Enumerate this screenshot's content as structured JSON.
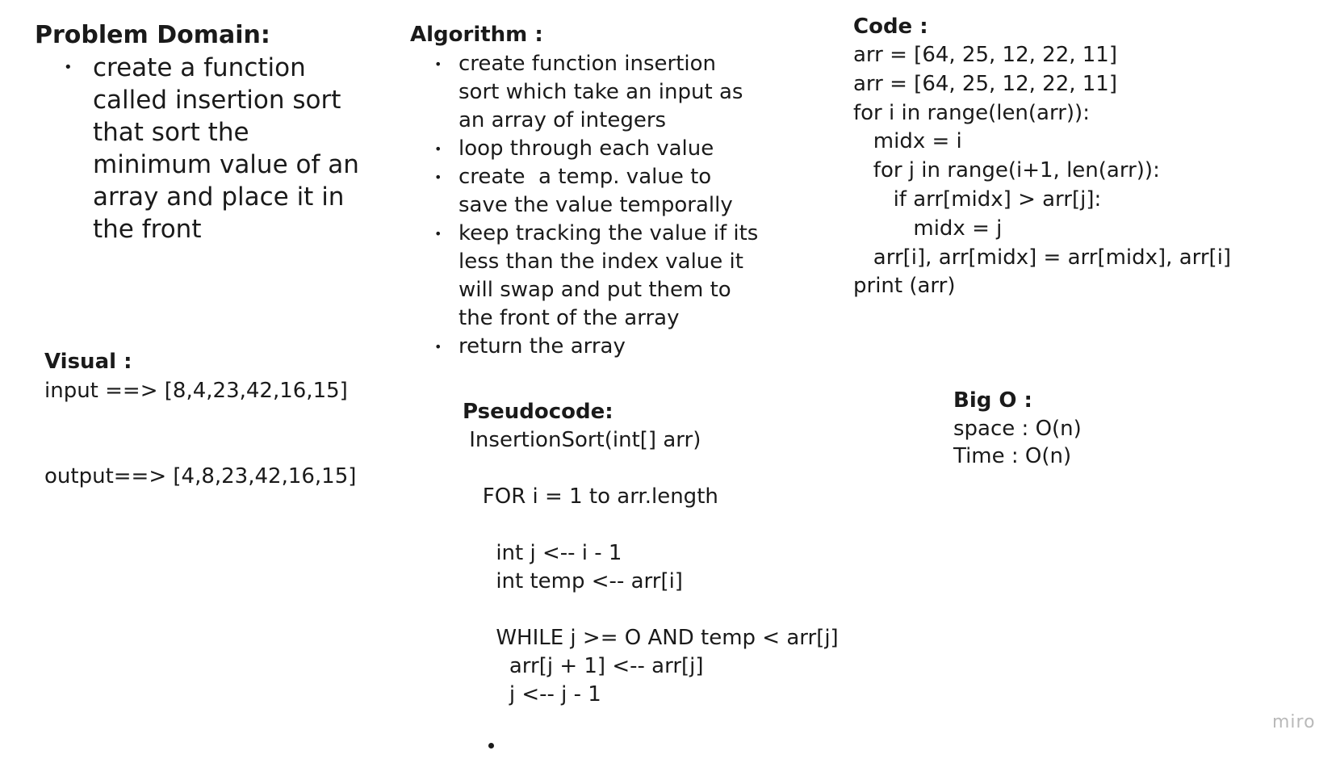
{
  "problem_domain": {
    "heading": "Problem Domain:",
    "items": [
      "create a function called insertion sort that sort the minimum value of an array and place it in the front"
    ]
  },
  "algorithm": {
    "heading": "Algorithm :",
    "items": [
      "create function insertion\nsort which take an input as\nan array of integers",
      "loop through each value",
      "create  a temp. value to\nsave the value temporally",
      "keep tracking the value if its\nless than the index value it\nwill swap and put them to\nthe front of the array",
      "return the array"
    ]
  },
  "code": {
    "heading": "Code :",
    "lines": [
      "arr = [64, 25, 12, 22, 11]",
      "arr = [64, 25, 12, 22, 11]",
      "for i in range(len(arr)):",
      "   midx = i",
      "   for j in range(i+1, len(arr)):",
      "      if arr[midx] > arr[j]:",
      "         midx = j",
      "   arr[i], arr[midx] = arr[midx], arr[i]",
      "print (arr)"
    ]
  },
  "visual": {
    "heading": "Visual :",
    "input": "input ==> [8,4,23,42,16,15]",
    "output": "output==> [4,8,23,42,16,15]"
  },
  "pseudocode": {
    "heading": "Pseudocode:",
    "lines": [
      " InsertionSort(int[] arr)",
      "",
      "   FOR i = 1 to arr.length",
      "",
      "     int j <-- i - 1",
      "     int temp <-- arr[i]",
      "",
      "     WHILE j >= O AND temp < arr[j]",
      "       arr[j + 1] <-- arr[j]",
      "       j <-- j - 1"
    ]
  },
  "big_o": {
    "heading": "Big O :",
    "space": "space : O(n)",
    "time": "Time : O(n)"
  },
  "watermark": "miro"
}
